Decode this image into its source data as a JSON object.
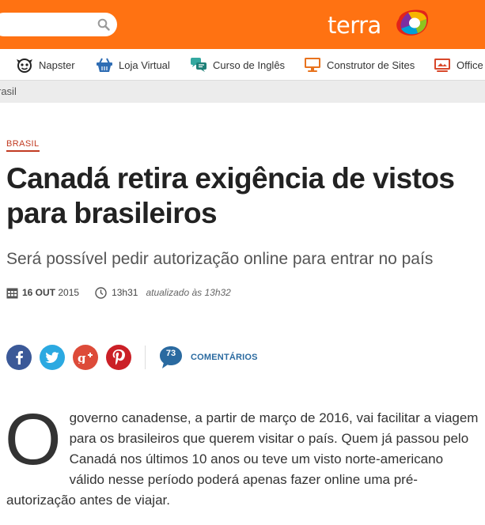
{
  "header": {
    "search_placeholder": "",
    "brand": "terra",
    "colors": {
      "header_bg": "#ff7212",
      "link_blue": "#2a6aa0",
      "kicker_red": "#c23b22"
    }
  },
  "services": [
    {
      "label": "Napster",
      "icon": "napster-icon"
    },
    {
      "label": "Loja Virtual",
      "icon": "shopping-basket-icon"
    },
    {
      "label": "Curso de Inglês",
      "icon": "speech-bubble-icon"
    },
    {
      "label": "Construtor de Sites",
      "icon": "monitor-icon"
    },
    {
      "label": "Office",
      "icon": "office-icon"
    }
  ],
  "breadcrumb": "rasil",
  "article": {
    "kicker": "BRASIL",
    "title": "Canadá retira exigência de vistos para brasileiros",
    "subtitle": "Será possível pedir autorização online para entrar no país",
    "date_day": "16 OUT",
    "date_year": "2015",
    "time": "13h31",
    "updated": "atualizado às 13h32",
    "comments_count": "73",
    "comments_label": "COMENTÁRIOS",
    "dropcap": "O",
    "body": "governo canadense, a partir de março de 2016, vai facilitar a viagem para os brasileiros que querem visitar o país. Quem já passou pelo Canadá nos últimos 10 anos ou teve um visto norte-americano válido nesse período poderá apenas fazer online uma pré-autorização antes de viajar."
  }
}
